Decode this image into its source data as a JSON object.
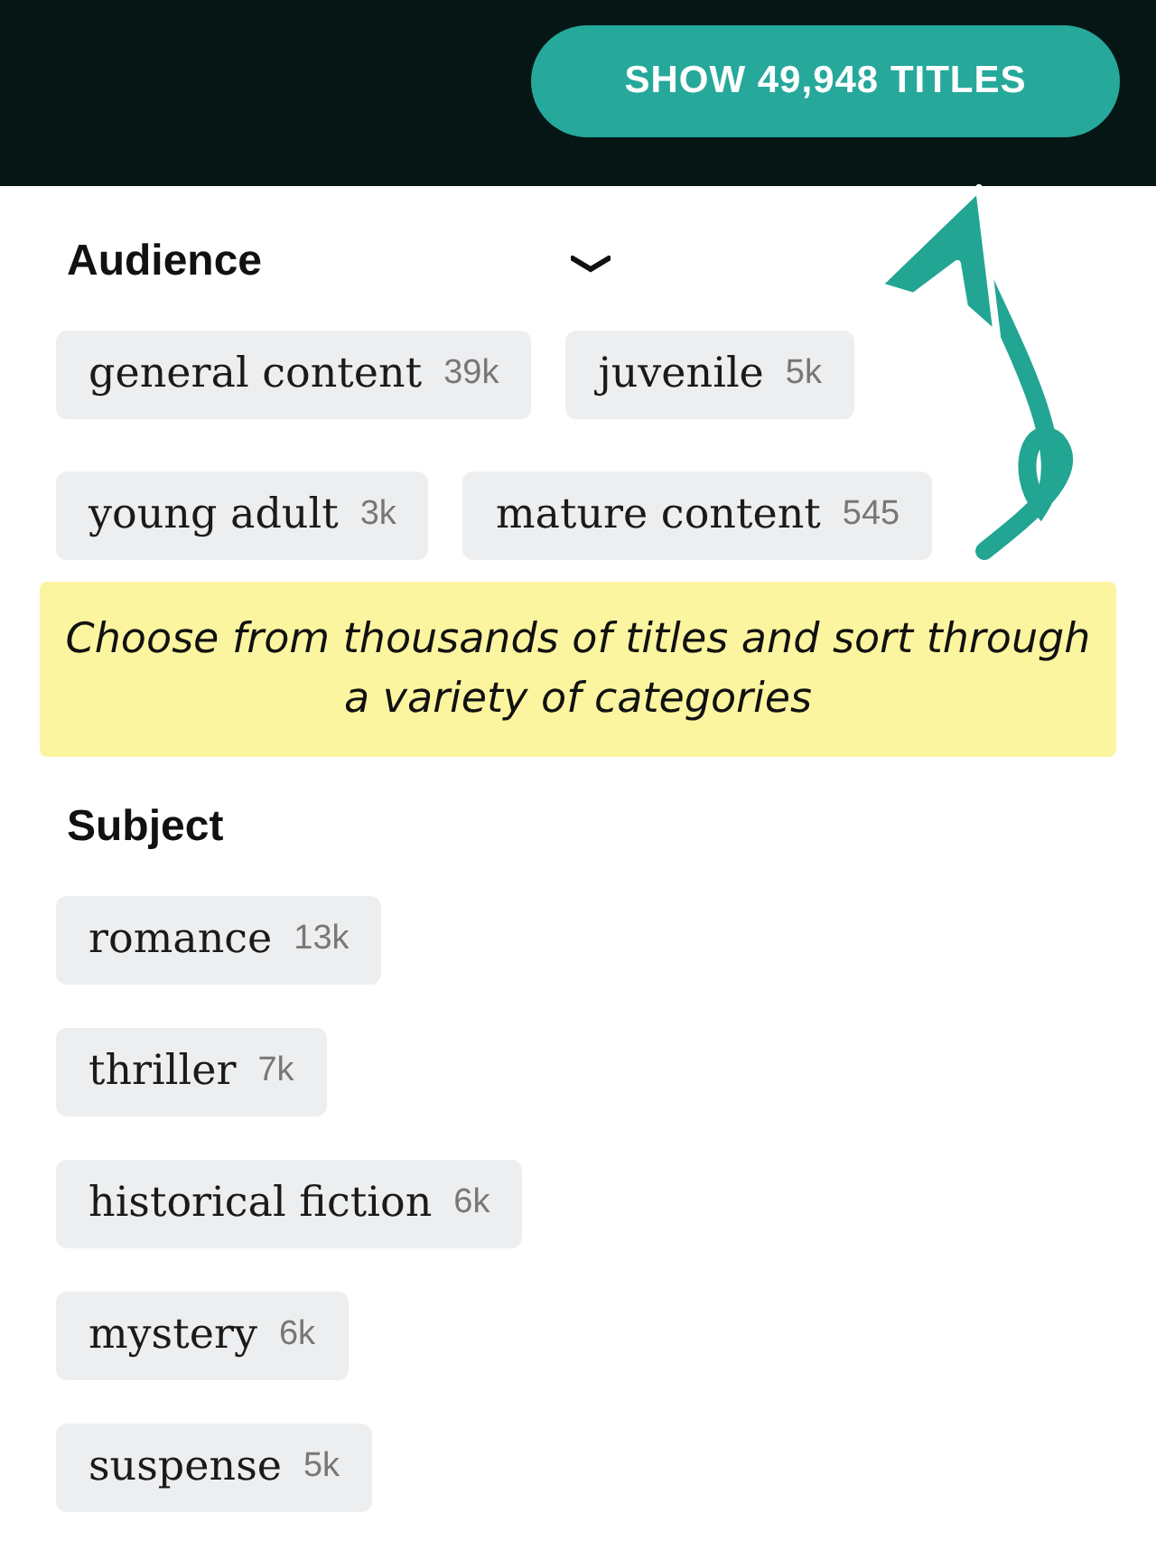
{
  "header": {
    "button": "SHOW 49,948 TITLES"
  },
  "sections": [
    {
      "title": "Audience",
      "kind": "wrap",
      "chips": [
        {
          "label": "general content",
          "count": "39k"
        },
        {
          "label": "juvenile",
          "count": "5k"
        },
        {
          "label": "young adult",
          "count": "3k"
        },
        {
          "label": "mature content",
          "count": "545"
        }
      ]
    },
    {
      "title": "Subject",
      "kind": "stack",
      "chips": [
        {
          "label": "romance",
          "count": "13k"
        },
        {
          "label": "thriller",
          "count": "7k"
        },
        {
          "label": "historical fiction",
          "count": "6k"
        },
        {
          "label": "mystery",
          "count": "6k"
        },
        {
          "label": "suspense",
          "count": "5k"
        }
      ]
    }
  ],
  "callout": {
    "text": "Choose from thousands of titles and sort through a variety of categories"
  }
}
